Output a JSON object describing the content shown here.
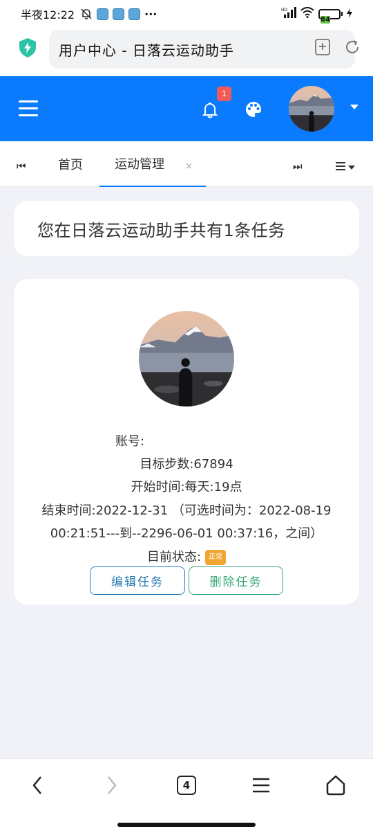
{
  "status_bar": {
    "time": "半夜12:22",
    "battery": "84",
    "network": "HD"
  },
  "browser": {
    "url_title": "用户中心 - 日落云运动助手",
    "tab_count": "4"
  },
  "header": {
    "notification_count": "1",
    "accent_color": "#0a7bff"
  },
  "tabs": {
    "home_label": "首页",
    "active_label": "运动管理",
    "close_symbol": "×"
  },
  "summary": {
    "text": "您在日落云运动助手共有1条任务"
  },
  "task": {
    "account_label": "账号:",
    "account_value": "",
    "steps_label": "目标步数:",
    "steps_value": "67894",
    "start_label": "开始时间:",
    "start_value": "每天:19点",
    "end_label": "结束时间:",
    "end_value": "2022-12-31",
    "range_text": "（可选时间为：2022-08-19 00:21:51---到--2296-06-01 00:37:16，之间）",
    "status_label": "目前状态:",
    "status_value": "正常",
    "edit_button": "编辑任务",
    "delete_button": "删除任务"
  }
}
